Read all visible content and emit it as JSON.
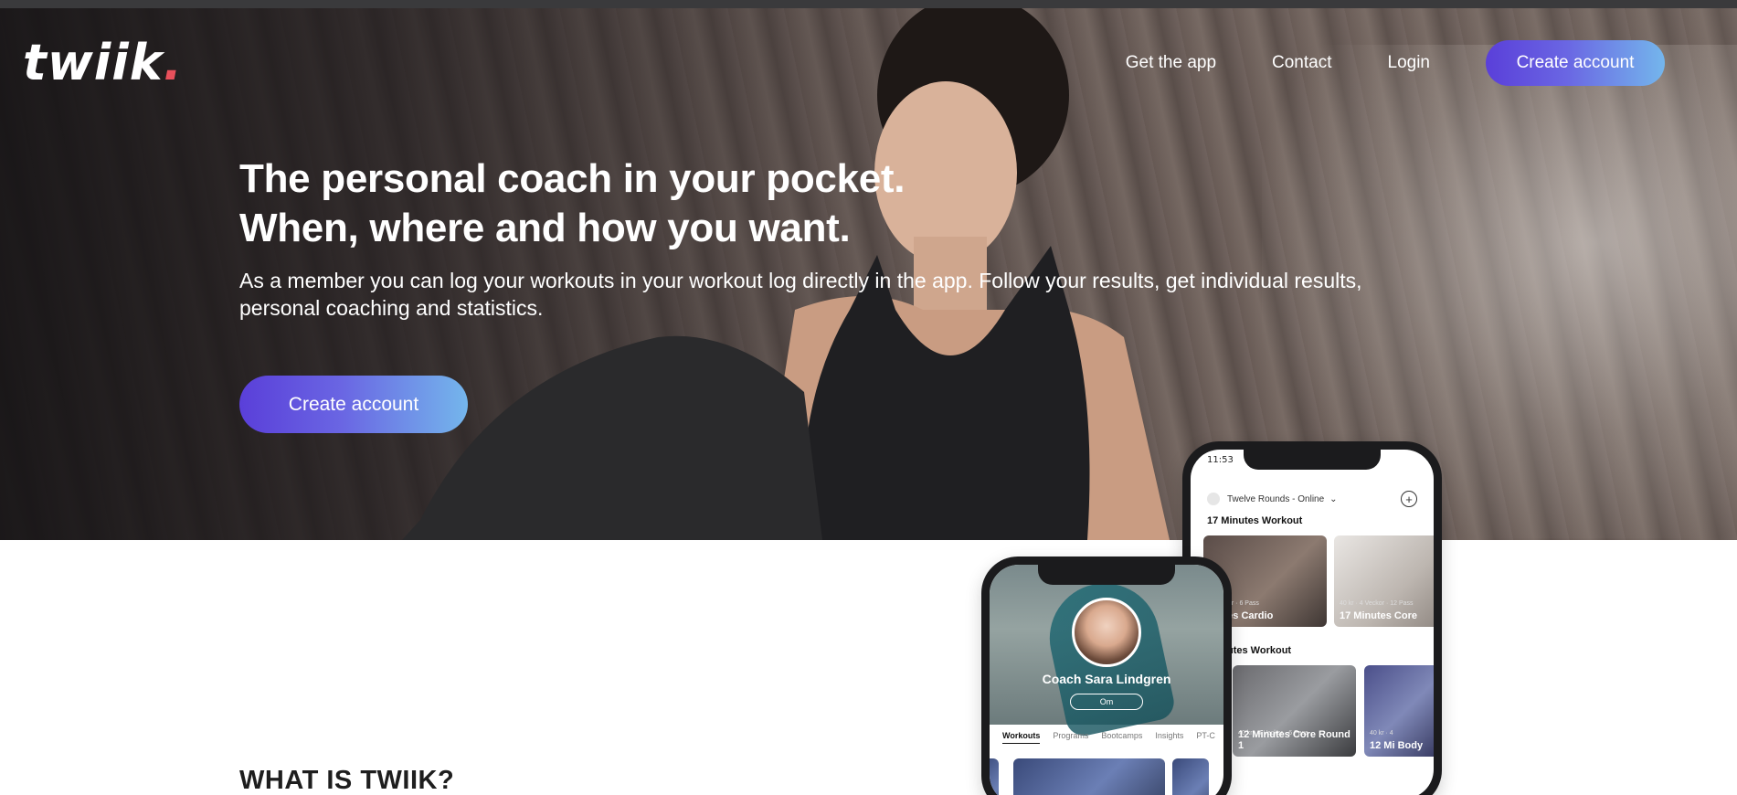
{
  "brand": {
    "logo_text": "twiik",
    "logo_dot": ".",
    "accent": "#e8505b"
  },
  "nav": {
    "items": [
      {
        "label": "Get the app"
      },
      {
        "label": "Contact"
      },
      {
        "label": "Login"
      }
    ],
    "cta_label": "Create account",
    "cta_gradient": [
      "#5a3fd9",
      "#74b6ec"
    ]
  },
  "hero": {
    "headline_line1": "The personal coach in your pocket.",
    "headline_line2": "When, where and how you want.",
    "subtext": "As a member you can log your workouts in your workout log directly in the app. Follow your results, get individual results, personal coaching and statistics.",
    "cta_label": "Create account"
  },
  "section": {
    "title": "WHAT IS TWIIK?"
  },
  "phone_back": {
    "status_time": "11:53",
    "account": "Twelve Rounds - Online",
    "section1": "17 Minutes Workout",
    "section2": "utes Workout",
    "cards_row1": [
      {
        "meta": "4 Veckor · 6 Pass",
        "title": "inutes Cardio"
      },
      {
        "meta": "40 kr · 4 Veckor · 12 Pass",
        "title": "17 Minutes Core"
      }
    ],
    "cards_row2": [
      {
        "meta": "40 kr · 4 Veckor · 6 Pass",
        "title": "12 Minutes Core Round 1"
      },
      {
        "meta": "40 kr · 4",
        "title": "12 Mi Body"
      }
    ]
  },
  "phone_front": {
    "coach_name": "Coach Sara Lindgren",
    "om_label": "Om",
    "tabs": [
      "Workouts",
      "Programs",
      "Bootcamps",
      "Insights",
      "PT-C"
    ]
  }
}
